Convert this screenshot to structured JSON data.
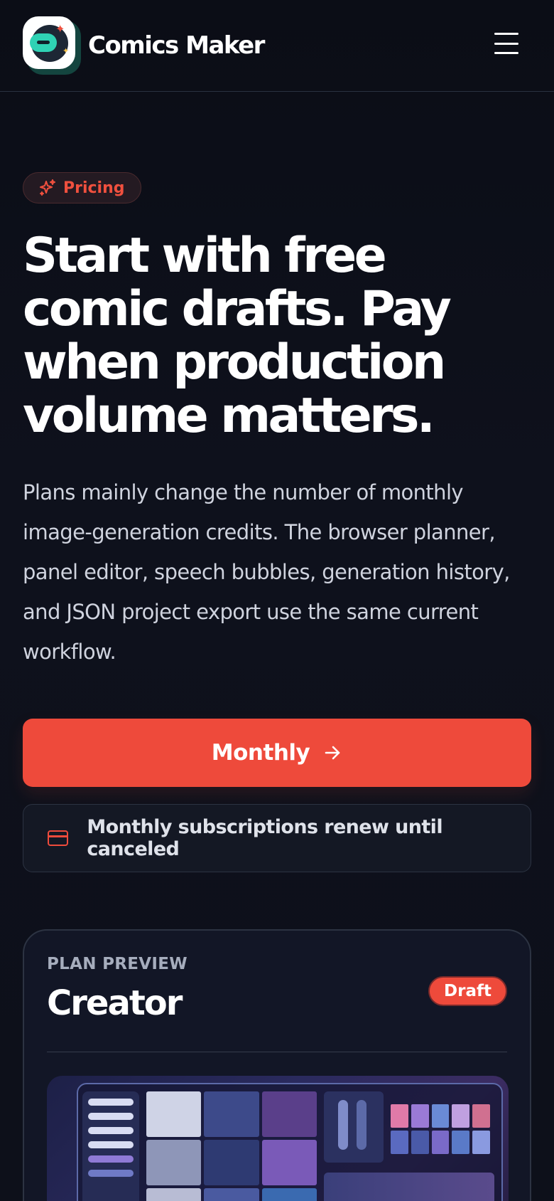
{
  "header": {
    "brand": "Comics Maker",
    "logo_icon": "comics-maker-logo",
    "menu_icon": "hamburger-menu-icon"
  },
  "badge": {
    "label": "Pricing",
    "icon": "sparkle-icon"
  },
  "hero": {
    "title": "Start with free comic drafts. Pay when production volume matters.",
    "description": "Plans mainly change the number of monthly image-generation credits. The browser planner, panel editor, speech bubbles, generation history, and JSON project export use the same current workflow."
  },
  "cta": {
    "label": "Monthly",
    "icon": "arrow-right-icon"
  },
  "note": {
    "label": "Monthly subscriptions renew until canceled",
    "icon": "credit-card-icon"
  },
  "plan": {
    "eyebrow": "PLAN PREVIEW",
    "name": "Creator",
    "status": "Draft"
  },
  "colors": {
    "accent": "#ee4a3b",
    "background": "#0e1019",
    "teal": "#2fd2b4"
  }
}
